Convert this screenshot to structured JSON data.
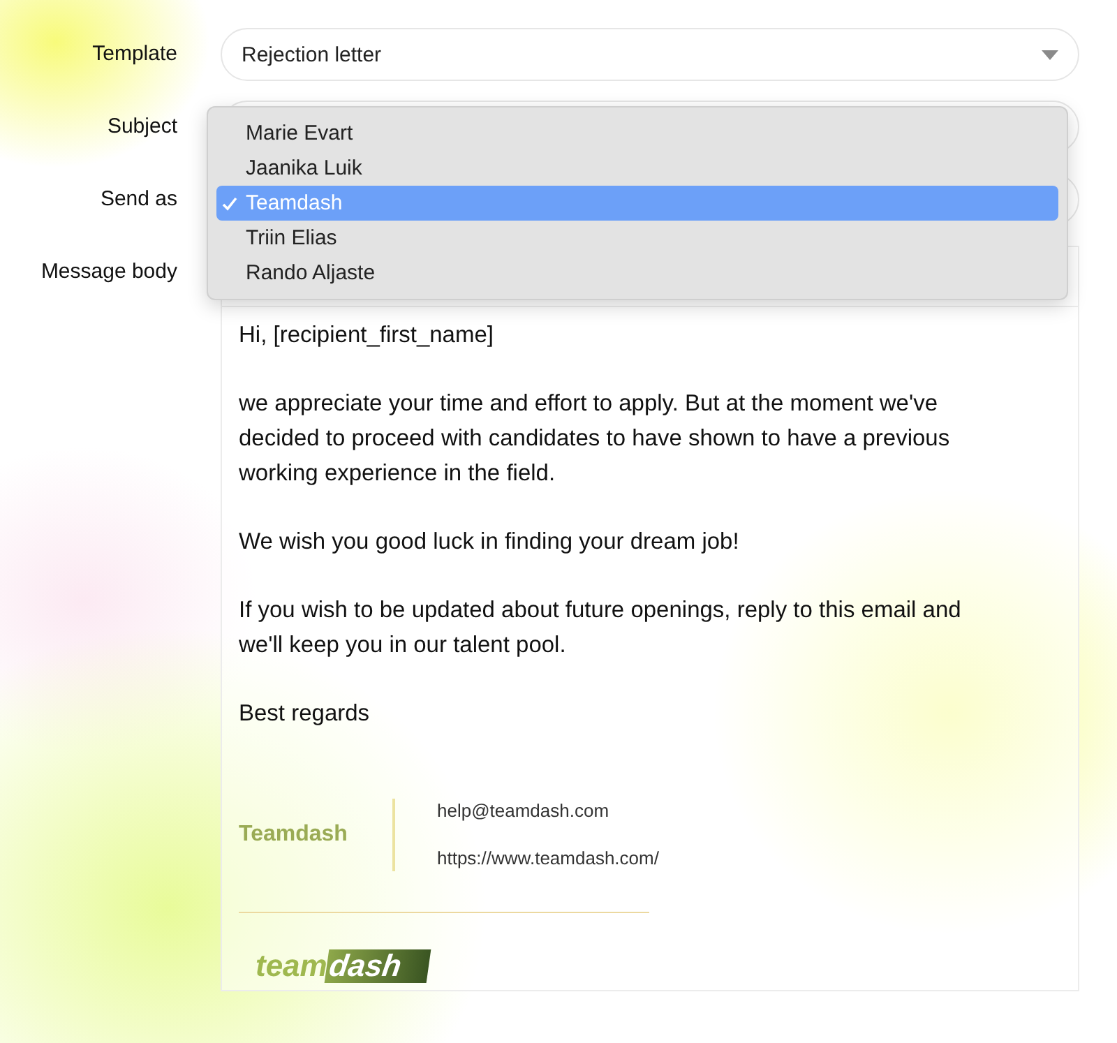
{
  "fields": [
    {
      "label": "Template",
      "kind": "select",
      "value": "Rejection letter"
    },
    {
      "label": "Subject",
      "kind": "text"
    },
    {
      "label": "Send as",
      "kind": "select"
    },
    {
      "label": "Message body",
      "kind": "editor"
    }
  ],
  "dropdown": {
    "options": [
      {
        "label": "Marie Evart",
        "selected": false
      },
      {
        "label": "Jaanika Luik",
        "selected": false
      },
      {
        "label": "Teamdash",
        "selected": true
      },
      {
        "label": "Triin Elias",
        "selected": false
      },
      {
        "label": "Rando Aljaste",
        "selected": false
      }
    ]
  },
  "message": {
    "paragraphs": [
      "Hi, [recipient_first_name]",
      "we appreciate your time and effort to apply. But at the moment we've decided to proceed with candidates to have shown to have a previous working experience in the field.",
      "We wish you good luck in finding your dream job!",
      "If you wish to be updated about future openings, reply to this email and we'll keep you in our talent pool.",
      "Best regards"
    ],
    "signature": {
      "name": "Teamdash",
      "email": "help@teamdash.com",
      "website": "https://www.teamdash.com/",
      "logo": {
        "part_1": "team",
        "part_2": "dash"
      }
    }
  }
}
